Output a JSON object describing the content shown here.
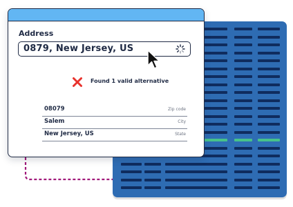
{
  "address_card": {
    "label": "Address",
    "input_value": "0879, New Jersey, US",
    "status_message": "Found 1 valid alternative",
    "results": [
      {
        "value": "08079",
        "type": "Zip code"
      },
      {
        "value": "Salem",
        "type": "City"
      },
      {
        "value": "New Jersey, US",
        "type": "State"
      }
    ]
  },
  "colors": {
    "header": "#62b6f3",
    "outline": "#1f2a44",
    "error": "#e8322c",
    "grid_background": "#2e6cb3",
    "grid_cell": "#0f2c5e",
    "grid_highlight": "#47c28a",
    "connector": "#cf52a6"
  },
  "icons": {
    "input_loading": "spinner-icon",
    "status": "x-mark-icon",
    "pointer": "cursor-arrow-icon"
  }
}
